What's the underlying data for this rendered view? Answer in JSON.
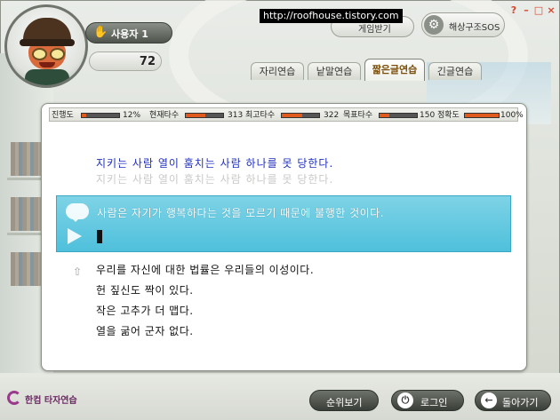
{
  "user": {
    "name": "사용자 1",
    "score": "72"
  },
  "watermark": "http://roofhouse.tistory.com",
  "top_buttons": {
    "game_label": "게임받기",
    "sos_label": "해상구조SOS"
  },
  "window_controls": {
    "help": "?",
    "minimize": "–",
    "maximize": "□",
    "close": "×"
  },
  "tabs": [
    "자리연습",
    "낱말연습",
    "짧은글연습",
    "긴글연습"
  ],
  "active_tab": "짧은글연습",
  "stats": [
    {
      "label": "진행도",
      "value": "12%",
      "level": 0.12
    },
    {
      "label": "현재타수",
      "value": "313",
      "level": 0.52
    },
    {
      "label": "최고타수",
      "value": "322",
      "level": 0.54
    },
    {
      "label": "목표타수",
      "value": "150",
      "level": 0.25
    },
    {
      "label": "정확도",
      "value": "100%",
      "level": 1.0
    }
  ],
  "prompt_sentence": "지키는 사람 열이 훔치는 사람 하나를 못 당한다.",
  "prompt_ghost": "지키는 사람 열이 훔치는 사람 하나를 못 당한다.",
  "current_sentence": "사람은 자기가 행복하다는 것을 모르기 때문에 불행한 것이다.",
  "input_value": "",
  "upcoming": [
    "우리를 자신에 대한 법률은 우리들의 이성이다.",
    "헌 짚신도 짝이 있다.",
    "작은 고추가 더 맵다.",
    "열을 굶어 군자 없다."
  ],
  "footer": {
    "logo_text": "한컴 타자연습",
    "ranking_label": "순위보기",
    "login_label": "로그인",
    "back_label": "돌아가기"
  }
}
